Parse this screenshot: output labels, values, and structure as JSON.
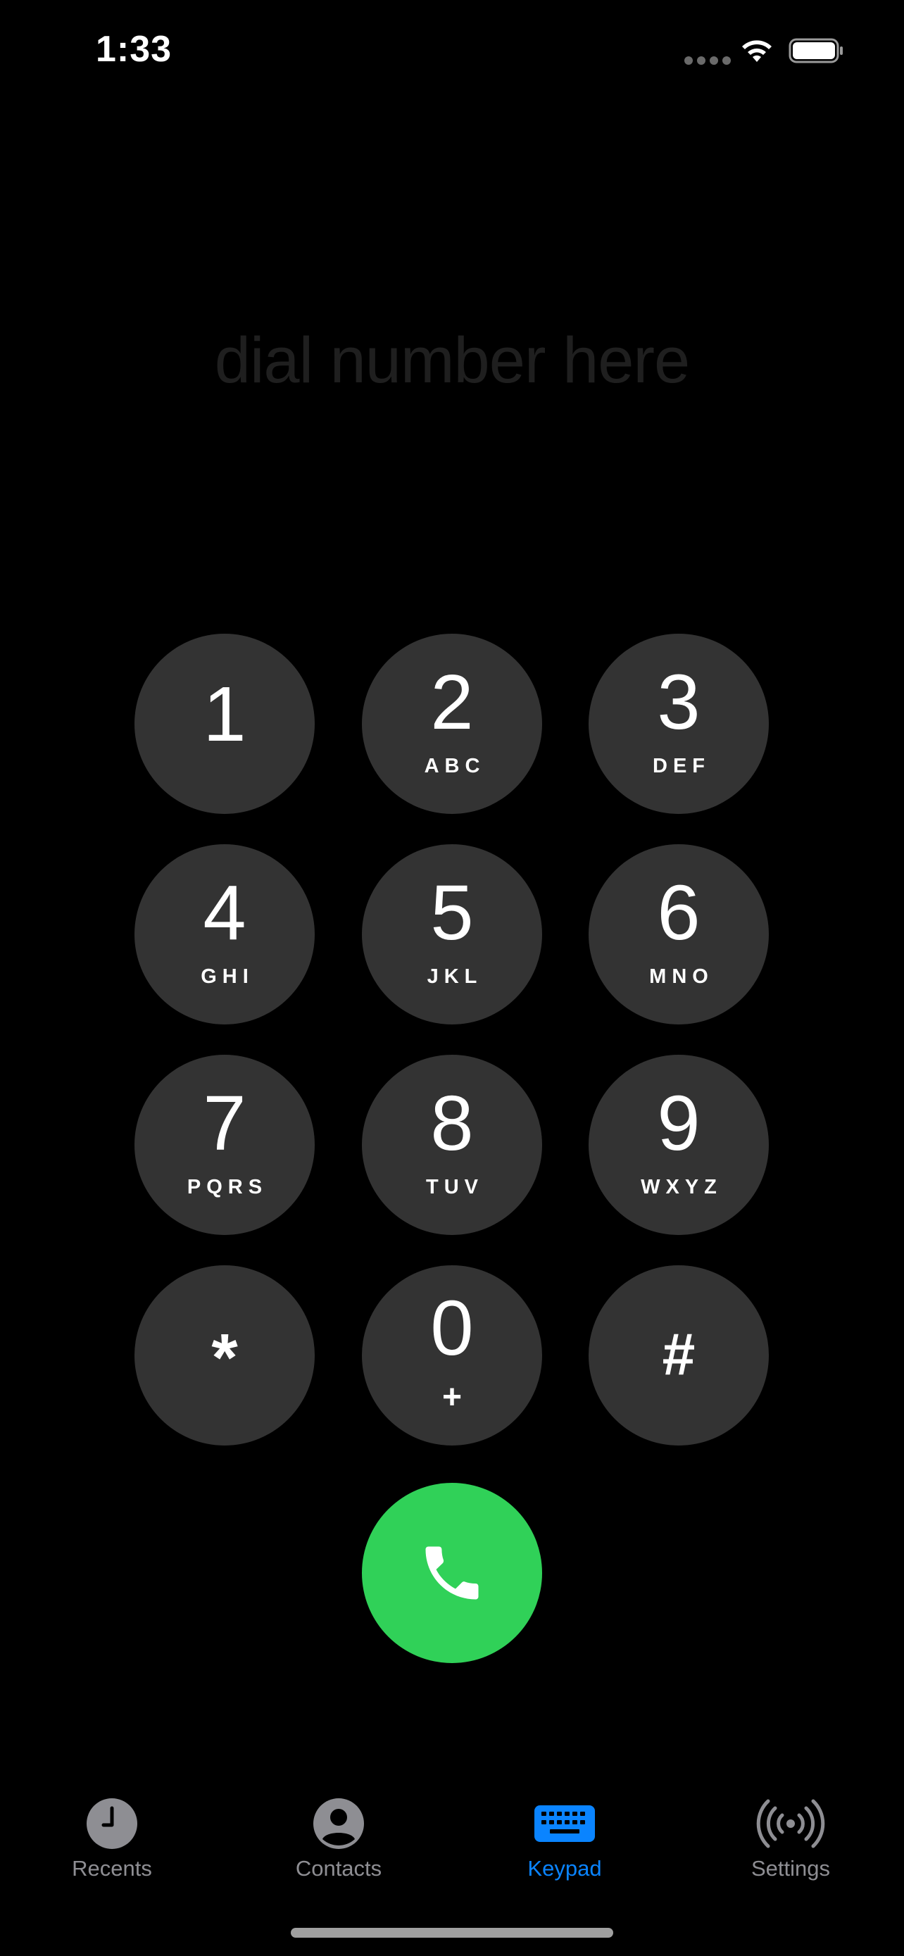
{
  "status_bar": {
    "time": "1:33"
  },
  "dial": {
    "placeholder": "dial number here"
  },
  "keypad": {
    "keys": [
      {
        "digit": "1",
        "letters": ""
      },
      {
        "digit": "2",
        "letters": "ABC"
      },
      {
        "digit": "3",
        "letters": "DEF"
      },
      {
        "digit": "4",
        "letters": "GHI"
      },
      {
        "digit": "5",
        "letters": "JKL"
      },
      {
        "digit": "6",
        "letters": "MNO"
      },
      {
        "digit": "7",
        "letters": "PQRS"
      },
      {
        "digit": "8",
        "letters": "TUV"
      },
      {
        "digit": "9",
        "letters": "WXYZ"
      },
      {
        "digit": "*",
        "letters": ""
      },
      {
        "digit": "0",
        "letters": "+"
      },
      {
        "digit": "#",
        "letters": ""
      }
    ],
    "call_icon": "phone-icon"
  },
  "tab_bar": {
    "tabs": [
      {
        "label": "Recents",
        "icon": "clock-icon",
        "active": false
      },
      {
        "label": "Contacts",
        "icon": "person-circle-icon",
        "active": false
      },
      {
        "label": "Keypad",
        "icon": "keypad-icon",
        "active": true
      },
      {
        "label": "Settings",
        "icon": "broadcast-icon",
        "active": false
      }
    ]
  },
  "colors": {
    "background": "#000000",
    "key": "#333333",
    "call": "#30d158",
    "accent": "#0a84ff",
    "inactive_tab": "#8e8e93",
    "placeholder": "#1f1f1f"
  }
}
